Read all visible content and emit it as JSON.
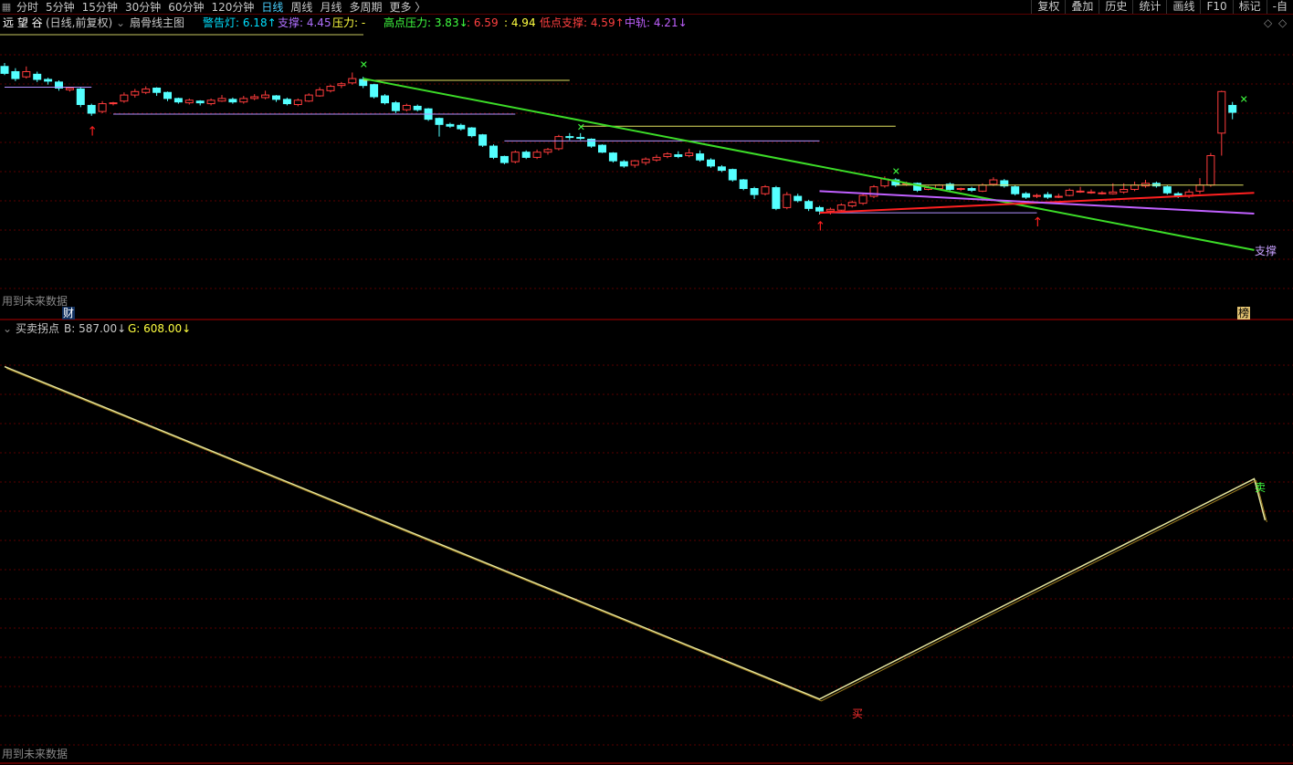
{
  "toolbar": {
    "periods": [
      "分时",
      "5分钟",
      "15分钟",
      "30分钟",
      "60分钟",
      "120分钟",
      "日线",
      "周线",
      "月线",
      "多周期",
      "更多 〉"
    ],
    "active_period": "日线",
    "actions": [
      "复权",
      "叠加",
      "历史",
      "统计",
      "画线",
      "F10",
      "标记",
      "-自"
    ]
  },
  "main_panel": {
    "stock_name": "远 望 谷",
    "period_note": "(日线,前复权)",
    "indicator_name": "扇骨线主图",
    "indicators": [
      {
        "label": "警告灯: 6.18↑",
        "color": "#00e0ff"
      },
      {
        "label": "支撑: 4.45",
        "color": "#b070ff"
      },
      {
        "label": "压力: -",
        "color": "#ffff40"
      },
      {
        "label": "高点压力: 3.83↓",
        "color": "#40ff40"
      },
      {
        "label": ": 6.59",
        "color": "#ff4040"
      },
      {
        "label": ": 4.94",
        "color": "#ffff40"
      },
      {
        "label": "低点支撑: 4.59↑",
        "color": "#ff4040"
      },
      {
        "label": "中轨: 4.21↓",
        "color": "#c060ff"
      }
    ],
    "support_label": "支撑",
    "footer_note": "用到未来数据",
    "marker_cai": "财",
    "marker_bang": "榜"
  },
  "sub_panel": {
    "title": "买卖拐点",
    "b_value": "B: 587.00↓",
    "g_value": "G: 608.00↓",
    "buy_label": "买",
    "sell_label": "卖",
    "footer_note": "用到未来数据"
  },
  "colors": {
    "up": "#ff3c3c",
    "down": "#54ffff",
    "green_line": "#3cdc28",
    "red_line": "#ff2020",
    "purple_line": "#c060ff",
    "yellow_line": "#e8e860",
    "grid": "#5a0000"
  },
  "chart_data": {
    "type": "candlestick",
    "main_price_range": [
      3.6,
      6.9
    ],
    "candles": [
      {
        "o": 6.47,
        "c": 6.39,
        "h": 6.51,
        "l": 6.37
      },
      {
        "o": 6.41,
        "c": 6.33,
        "h": 6.45,
        "l": 6.3
      },
      {
        "o": 6.35,
        "c": 6.41,
        "h": 6.47,
        "l": 6.33
      },
      {
        "o": 6.38,
        "c": 6.32,
        "h": 6.41,
        "l": 6.29
      },
      {
        "o": 6.32,
        "c": 6.3,
        "h": 6.34,
        "l": 6.26
      },
      {
        "o": 6.29,
        "c": 6.22,
        "h": 6.31,
        "l": 6.19
      },
      {
        "o": 6.2,
        "c": 6.22,
        "h": 6.23,
        "l": 6.18
      },
      {
        "o": 6.21,
        "c": 6.03,
        "h": 6.23,
        "l": 6.0
      },
      {
        "o": 6.02,
        "c": 5.93,
        "h": 6.04,
        "l": 5.9
      },
      {
        "o": 5.95,
        "c": 6.04,
        "h": 6.07,
        "l": 5.93
      },
      {
        "o": 6.04,
        "c": 6.05,
        "h": 6.06,
        "l": 6.02
      },
      {
        "o": 6.07,
        "c": 6.14,
        "h": 6.17,
        "l": 6.05
      },
      {
        "o": 6.14,
        "c": 6.18,
        "h": 6.21,
        "l": 6.11
      },
      {
        "o": 6.17,
        "c": 6.21,
        "h": 6.24,
        "l": 6.15
      },
      {
        "o": 6.22,
        "c": 6.17,
        "h": 6.23,
        "l": 6.13
      },
      {
        "o": 6.17,
        "c": 6.1,
        "h": 6.18,
        "l": 6.07
      },
      {
        "o": 6.1,
        "c": 6.06,
        "h": 6.11,
        "l": 6.04
      },
      {
        "o": 6.05,
        "c": 6.08,
        "h": 6.1,
        "l": 6.03
      },
      {
        "o": 6.07,
        "c": 6.05,
        "h": 6.08,
        "l": 6.02
      },
      {
        "o": 6.04,
        "c": 6.08,
        "h": 6.1,
        "l": 6.02
      },
      {
        "o": 6.07,
        "c": 6.1,
        "h": 6.14,
        "l": 6.06
      },
      {
        "o": 6.09,
        "c": 6.06,
        "h": 6.11,
        "l": 6.04
      },
      {
        "o": 6.06,
        "c": 6.1,
        "h": 6.13,
        "l": 6.04
      },
      {
        "o": 6.1,
        "c": 6.12,
        "h": 6.15,
        "l": 6.08
      },
      {
        "o": 6.11,
        "c": 6.14,
        "h": 6.19,
        "l": 6.09
      },
      {
        "o": 6.13,
        "c": 6.09,
        "h": 6.14,
        "l": 6.06
      },
      {
        "o": 6.09,
        "c": 6.04,
        "h": 6.11,
        "l": 6.02
      },
      {
        "o": 6.03,
        "c": 6.08,
        "h": 6.1,
        "l": 6.01
      },
      {
        "o": 6.07,
        "c": 6.14,
        "h": 6.16,
        "l": 6.06
      },
      {
        "o": 6.13,
        "c": 6.2,
        "h": 6.23,
        "l": 6.12
      },
      {
        "o": 6.19,
        "c": 6.24,
        "h": 6.26,
        "l": 6.17
      },
      {
        "o": 6.25,
        "c": 6.27,
        "h": 6.29,
        "l": 6.22
      },
      {
        "o": 6.28,
        "c": 6.33,
        "h": 6.4,
        "l": 6.26
      },
      {
        "o": 6.32,
        "c": 6.25,
        "h": 6.35,
        "l": 6.22
      },
      {
        "o": 6.26,
        "c": 6.12,
        "h": 6.27,
        "l": 6.1
      },
      {
        "o": 6.13,
        "c": 6.05,
        "h": 6.15,
        "l": 6.03
      },
      {
        "o": 6.05,
        "c": 5.96,
        "h": 6.07,
        "l": 5.93
      },
      {
        "o": 5.97,
        "c": 6.02,
        "h": 6.04,
        "l": 5.95
      },
      {
        "o": 6.01,
        "c": 5.97,
        "h": 6.03,
        "l": 5.95
      },
      {
        "o": 5.98,
        "c": 5.86,
        "h": 5.99,
        "l": 5.84
      },
      {
        "o": 5.87,
        "c": 5.8,
        "h": 5.88,
        "l": 5.66
      },
      {
        "o": 5.8,
        "c": 5.78,
        "h": 5.82,
        "l": 5.76
      },
      {
        "o": 5.79,
        "c": 5.75,
        "h": 5.81,
        "l": 5.73
      },
      {
        "o": 5.76,
        "c": 5.67,
        "h": 5.77,
        "l": 5.65
      },
      {
        "o": 5.68,
        "c": 5.56,
        "h": 5.69,
        "l": 5.54
      },
      {
        "o": 5.55,
        "c": 5.42,
        "h": 5.57,
        "l": 5.4
      },
      {
        "o": 5.43,
        "c": 5.36,
        "h": 5.44,
        "l": 5.34
      },
      {
        "o": 5.37,
        "c": 5.48,
        "h": 5.5,
        "l": 5.35
      },
      {
        "o": 5.48,
        "c": 5.42,
        "h": 5.5,
        "l": 5.4
      },
      {
        "o": 5.42,
        "c": 5.48,
        "h": 5.51,
        "l": 5.4
      },
      {
        "o": 5.48,
        "c": 5.51,
        "h": 5.53,
        "l": 5.45
      },
      {
        "o": 5.52,
        "c": 5.66,
        "h": 5.68,
        "l": 5.5
      },
      {
        "o": 5.66,
        "c": 5.65,
        "h": 5.7,
        "l": 5.62
      },
      {
        "o": 5.65,
        "c": 5.64,
        "h": 5.7,
        "l": 5.62
      },
      {
        "o": 5.63,
        "c": 5.55,
        "h": 5.64,
        "l": 5.53
      },
      {
        "o": 5.56,
        "c": 5.48,
        "h": 5.57,
        "l": 5.47
      },
      {
        "o": 5.47,
        "c": 5.38,
        "h": 5.48,
        "l": 5.36
      },
      {
        "o": 5.37,
        "c": 5.32,
        "h": 5.39,
        "l": 5.3
      },
      {
        "o": 5.33,
        "c": 5.38,
        "h": 5.39,
        "l": 5.3
      },
      {
        "o": 5.36,
        "c": 5.4,
        "h": 5.42,
        "l": 5.33
      },
      {
        "o": 5.39,
        "c": 5.42,
        "h": 5.45,
        "l": 5.37
      },
      {
        "o": 5.43,
        "c": 5.46,
        "h": 5.48,
        "l": 5.41
      },
      {
        "o": 5.45,
        "c": 5.43,
        "h": 5.49,
        "l": 5.41
      },
      {
        "o": 5.44,
        "c": 5.47,
        "h": 5.52,
        "l": 5.42
      },
      {
        "o": 5.46,
        "c": 5.39,
        "h": 5.5,
        "l": 5.37
      },
      {
        "o": 5.39,
        "c": 5.32,
        "h": 5.41,
        "l": 5.3
      },
      {
        "o": 5.31,
        "c": 5.27,
        "h": 5.33,
        "l": 5.25
      },
      {
        "o": 5.28,
        "c": 5.16,
        "h": 5.29,
        "l": 5.14
      },
      {
        "o": 5.16,
        "c": 5.06,
        "h": 5.17,
        "l": 5.04
      },
      {
        "o": 5.06,
        "c": 4.99,
        "h": 5.08,
        "l": 4.94
      },
      {
        "o": 5.0,
        "c": 5.08,
        "h": 5.1,
        "l": 4.98
      },
      {
        "o": 5.07,
        "c": 4.83,
        "h": 5.09,
        "l": 4.81
      },
      {
        "o": 4.84,
        "c": 4.99,
        "h": 5.02,
        "l": 4.82
      },
      {
        "o": 4.97,
        "c": 4.92,
        "h": 5.0,
        "l": 4.9
      },
      {
        "o": 4.91,
        "c": 4.83,
        "h": 4.93,
        "l": 4.8
      },
      {
        "o": 4.84,
        "c": 4.8,
        "h": 4.86,
        "l": 4.76
      },
      {
        "o": 4.8,
        "c": 4.82,
        "h": 4.84,
        "l": 4.76
      },
      {
        "o": 4.81,
        "c": 4.87,
        "h": 4.89,
        "l": 4.79
      },
      {
        "o": 4.86,
        "c": 4.9,
        "h": 4.92,
        "l": 4.84
      },
      {
        "o": 4.89,
        "c": 4.98,
        "h": 5.0,
        "l": 4.87
      },
      {
        "o": 4.97,
        "c": 5.08,
        "h": 5.1,
        "l": 4.95
      },
      {
        "o": 5.09,
        "c": 5.17,
        "h": 5.2,
        "l": 5.07
      },
      {
        "o": 5.16,
        "c": 5.1,
        "h": 5.18,
        "l": 5.08
      },
      {
        "o": 5.11,
        "c": 5.12,
        "h": 5.14,
        "l": 5.09
      },
      {
        "o": 5.12,
        "c": 5.04,
        "h": 5.13,
        "l": 5.02
      },
      {
        "o": 5.05,
        "c": 5.07,
        "h": 5.09,
        "l": 5.04
      },
      {
        "o": 5.06,
        "c": 5.1,
        "h": 5.11,
        "l": 5.05
      },
      {
        "o": 5.11,
        "c": 5.05,
        "h": 5.13,
        "l": 5.03
      },
      {
        "o": 5.05,
        "c": 5.06,
        "h": 5.07,
        "l": 5.03
      },
      {
        "o": 5.06,
        "c": 5.04,
        "h": 5.08,
        "l": 5.02
      },
      {
        "o": 5.03,
        "c": 5.1,
        "h": 5.12,
        "l": 5.02
      },
      {
        "o": 5.11,
        "c": 5.16,
        "h": 5.19,
        "l": 5.09
      },
      {
        "o": 5.15,
        "c": 5.09,
        "h": 5.17,
        "l": 5.07
      },
      {
        "o": 5.08,
        "c": 5.0,
        "h": 5.1,
        "l": 4.98
      },
      {
        "o": 5.0,
        "c": 4.96,
        "h": 5.02,
        "l": 4.94
      },
      {
        "o": 4.97,
        "c": 4.98,
        "h": 5.0,
        "l": 4.95
      },
      {
        "o": 4.99,
        "c": 4.96,
        "h": 5.02,
        "l": 4.94
      },
      {
        "o": 4.97,
        "c": 4.97,
        "h": 5.0,
        "l": 4.95
      },
      {
        "o": 4.98,
        "c": 5.04,
        "h": 5.06,
        "l": 4.97
      },
      {
        "o": 5.03,
        "c": 5.03,
        "h": 5.08,
        "l": 5.01
      },
      {
        "o": 5.02,
        "c": 5.02,
        "h": 5.05,
        "l": 5.0
      },
      {
        "o": 5.01,
        "c": 5.01,
        "h": 5.03,
        "l": 4.99
      },
      {
        "o": 5.0,
        "c": 5.02,
        "h": 5.12,
        "l": 4.99
      },
      {
        "o": 5.02,
        "c": 5.05,
        "h": 5.12,
        "l": 5.0
      },
      {
        "o": 5.05,
        "c": 5.1,
        "h": 5.14,
        "l": 5.03
      },
      {
        "o": 5.09,
        "c": 5.12,
        "h": 5.16,
        "l": 5.07
      },
      {
        "o": 5.12,
        "c": 5.09,
        "h": 5.14,
        "l": 5.07
      },
      {
        "o": 5.08,
        "c": 5.01,
        "h": 5.1,
        "l": 4.99
      },
      {
        "o": 5.0,
        "c": 4.97,
        "h": 5.02,
        "l": 4.95
      },
      {
        "o": 4.97,
        "c": 5.02,
        "h": 5.05,
        "l": 4.95
      },
      {
        "o": 5.03,
        "c": 5.1,
        "h": 5.18,
        "l": 5.0
      },
      {
        "o": 5.1,
        "c": 5.44,
        "h": 5.47,
        "l": 5.08
      },
      {
        "o": 5.7,
        "c": 6.18,
        "h": 6.19,
        "l": 5.44
      },
      {
        "o": 6.02,
        "c": 5.94,
        "h": 6.06,
        "l": 5.86
      }
    ],
    "sub_range": [
      200,
      620
    ],
    "sub_line": [
      {
        "i": 0,
        "v": 587
      },
      {
        "i": 75,
        "v": 258
      },
      {
        "i": 115,
        "v": 476
      },
      {
        "i": 116,
        "v": 435
      }
    ]
  }
}
